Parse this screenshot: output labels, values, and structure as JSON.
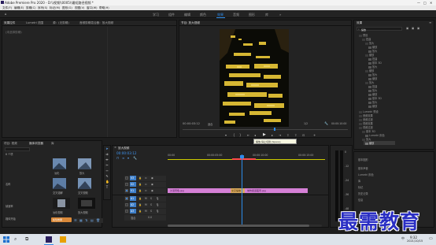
{
  "titlebar": {
    "title": "Adobe Premiere Pro 2020 - D:\\\\视频\\\\0005\\\\最短路径视频 *"
  },
  "menubar": [
    "文件(F)",
    "编辑(E)",
    "剪辑(C)",
    "序列(S)",
    "标记(M)",
    "图形(G)",
    "视图(V)",
    "窗口(W)",
    "帮助(H)"
  ],
  "workspaces": {
    "items": [
      "学习",
      "组件",
      "编辑",
      "颜色",
      "效果",
      "音频",
      "图形",
      "库"
    ],
    "active": "效果"
  },
  "source_panel": {
    "tabs": [
      "效果控件",
      "Lumetri 范围",
      "源：(无剪辑)",
      "音频剪辑混合器：放大视频"
    ],
    "placeholder": "(未选择剪辑)"
  },
  "program": {
    "tab": "节目: 放大视频",
    "timecode_left": "00:00:03:12",
    "fit": "适合",
    "quality": "1/2",
    "timecode_right": "00:00:10:00",
    "tooltip": "播放-停止切换 (Space)"
  },
  "effects_panel": {
    "title": "效果",
    "search": "缩放",
    "tree": [
      "预设",
      "Lumetri 预设",
      "音频效果",
      "音频过渡",
      "视频效果",
      "视频过渡"
    ],
    "subtree": [
      "扭曲",
      "放大",
      "缩放",
      "基本 3D",
      "Lumetri 颜色"
    ],
    "right_items": [
      "基本图形",
      "基本声音",
      "Lumetri 颜色",
      "库",
      "标记",
      "历史记录",
      "信息"
    ]
  },
  "project_panel": {
    "tabs": [
      "项目: 视频",
      "媒体浏览器",
      "库"
    ],
    "count": "6 个项",
    "items": [
      {
        "label": "淡化"
      },
      {
        "label": "放大"
      },
      {
        "label": "交叉溶解"
      },
      {
        "label": "交叉视频"
      },
      {
        "label": "淡化视频"
      },
      {
        "label": "放大视频"
      }
    ],
    "side_labels": [
      "名称",
      "帧速率",
      "媒体开始"
    ],
    "footer": "在位效果"
  },
  "timeline": {
    "tab": "放大视频",
    "timecode": "00:00:03:12",
    "ruler": [
      "00:00",
      "00:00:05:00",
      "00:00:10:00",
      "00:00:15:00"
    ],
    "video_tracks": [
      "V3",
      "V2",
      "V1"
    ],
    "audio_tracks": [
      "A1",
      "A2",
      "A3"
    ],
    "mix": "混合",
    "mix_value": "0.0",
    "clip1": "沙漠景色.jpg",
    "transition": "交叉缩放",
    "clip2": "城市街道夜景.jpg",
    "db_labels": [
      "0",
      "-12",
      "-24",
      "-36",
      "-48",
      "dB"
    ]
  },
  "taskbar": {
    "time": "9:32",
    "date": "2021/10/15",
    "lang": "中"
  },
  "watermark": "最需教育",
  "colors": {
    "accent": "#2d8ceb",
    "clip": "#d580d6",
    "transition": "#d9a95d",
    "panel_bg": "#232323"
  }
}
